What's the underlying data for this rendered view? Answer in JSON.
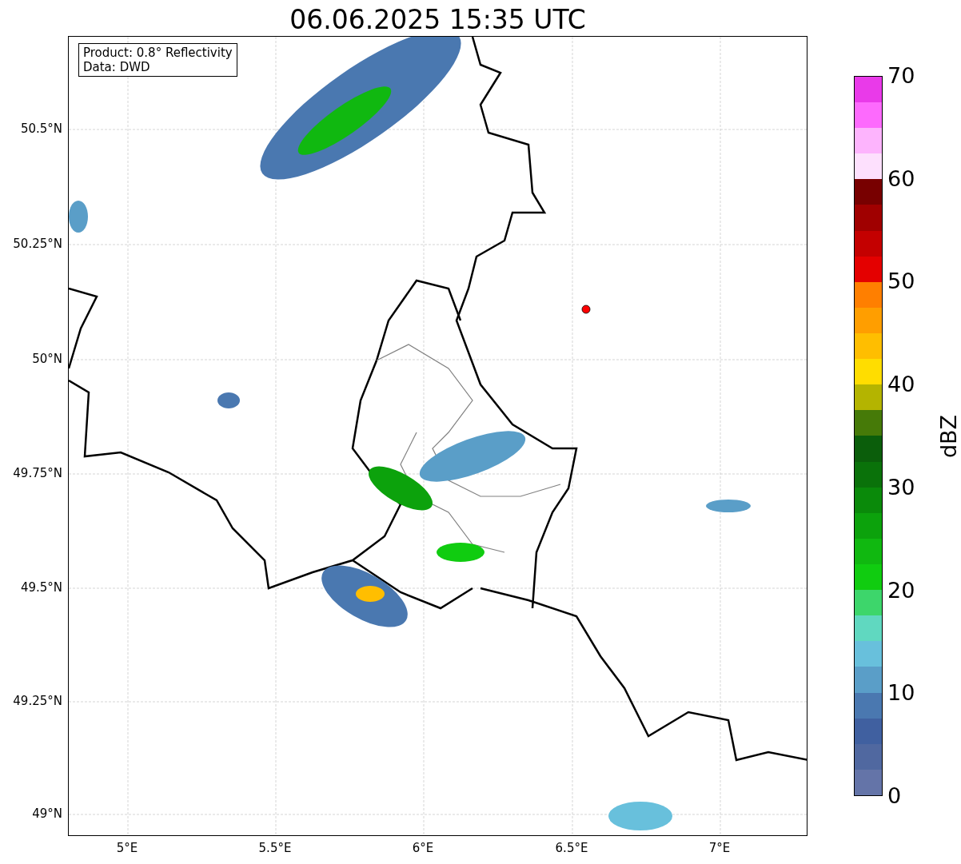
{
  "title": "06.06.2025 15:35 UTC",
  "legend": {
    "lines": [
      "Product: 0.8° Reflectivity",
      "Data: DWD"
    ]
  },
  "y_axis": {
    "ticks": [
      "50.5°N",
      "50.25°N",
      "50°N",
      "49.75°N",
      "49.5°N",
      "49.25°N",
      "49°N"
    ]
  },
  "x_axis": {
    "ticks": [
      "5°E",
      "5.5°E",
      "6°E",
      "6.5°E",
      "7°E"
    ]
  },
  "colorbar": {
    "label": "dBZ",
    "ticks": [
      "70",
      "60",
      "50",
      "40",
      "30",
      "20",
      "10",
      "0"
    ],
    "bins": [
      {
        "color": "#6474a8"
      },
      {
        "color": "#5068a0"
      },
      {
        "color": "#4060a0"
      },
      {
        "color": "#4a78b0"
      },
      {
        "color": "#5a9ec8"
      },
      {
        "color": "#68c0dc"
      },
      {
        "color": "#60d8c0"
      },
      {
        "color": "#3dd66b"
      },
      {
        "color": "#10cc10"
      },
      {
        "color": "#10b810"
      },
      {
        "color": "#0ca20c"
      },
      {
        "color": "#0a8a0a"
      },
      {
        "color": "#0a720a"
      },
      {
        "color": "#0b5e0b"
      },
      {
        "color": "#467a08"
      },
      {
        "color": "#b4b400"
      },
      {
        "color": "#ffdd00"
      },
      {
        "color": "#ffbe00"
      },
      {
        "color": "#ff9e00"
      },
      {
        "color": "#ff7f00"
      },
      {
        "color": "#e40000"
      },
      {
        "color": "#c40000"
      },
      {
        "color": "#a00000"
      },
      {
        "color": "#780000"
      },
      {
        "color": "#fde0fd"
      },
      {
        "color": "#fdb4fd"
      },
      {
        "color": "#fd6afd"
      },
      {
        "color": "#e93ae9"
      }
    ]
  }
}
